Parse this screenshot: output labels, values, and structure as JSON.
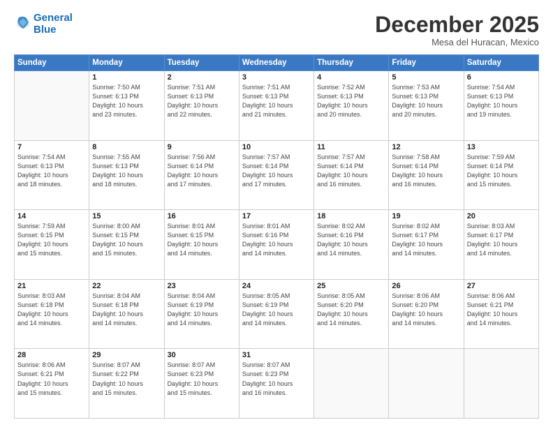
{
  "header": {
    "logo_line1": "General",
    "logo_line2": "Blue",
    "month": "December 2025",
    "location": "Mesa del Huracan, Mexico"
  },
  "weekdays": [
    "Sunday",
    "Monday",
    "Tuesday",
    "Wednesday",
    "Thursday",
    "Friday",
    "Saturday"
  ],
  "weeks": [
    [
      {
        "day": "",
        "info": ""
      },
      {
        "day": "1",
        "info": "Sunrise: 7:50 AM\nSunset: 6:13 PM\nDaylight: 10 hours\nand 23 minutes."
      },
      {
        "day": "2",
        "info": "Sunrise: 7:51 AM\nSunset: 6:13 PM\nDaylight: 10 hours\nand 22 minutes."
      },
      {
        "day": "3",
        "info": "Sunrise: 7:51 AM\nSunset: 6:13 PM\nDaylight: 10 hours\nand 21 minutes."
      },
      {
        "day": "4",
        "info": "Sunrise: 7:52 AM\nSunset: 6:13 PM\nDaylight: 10 hours\nand 20 minutes."
      },
      {
        "day": "5",
        "info": "Sunrise: 7:53 AM\nSunset: 6:13 PM\nDaylight: 10 hours\nand 20 minutes."
      },
      {
        "day": "6",
        "info": "Sunrise: 7:54 AM\nSunset: 6:13 PM\nDaylight: 10 hours\nand 19 minutes."
      }
    ],
    [
      {
        "day": "7",
        "info": "Sunrise: 7:54 AM\nSunset: 6:13 PM\nDaylight: 10 hours\nand 18 minutes."
      },
      {
        "day": "8",
        "info": "Sunrise: 7:55 AM\nSunset: 6:13 PM\nDaylight: 10 hours\nand 18 minutes."
      },
      {
        "day": "9",
        "info": "Sunrise: 7:56 AM\nSunset: 6:14 PM\nDaylight: 10 hours\nand 17 minutes."
      },
      {
        "day": "10",
        "info": "Sunrise: 7:57 AM\nSunset: 6:14 PM\nDaylight: 10 hours\nand 17 minutes."
      },
      {
        "day": "11",
        "info": "Sunrise: 7:57 AM\nSunset: 6:14 PM\nDaylight: 10 hours\nand 16 minutes."
      },
      {
        "day": "12",
        "info": "Sunrise: 7:58 AM\nSunset: 6:14 PM\nDaylight: 10 hours\nand 16 minutes."
      },
      {
        "day": "13",
        "info": "Sunrise: 7:59 AM\nSunset: 6:14 PM\nDaylight: 10 hours\nand 15 minutes."
      }
    ],
    [
      {
        "day": "14",
        "info": "Sunrise: 7:59 AM\nSunset: 6:15 PM\nDaylight: 10 hours\nand 15 minutes."
      },
      {
        "day": "15",
        "info": "Sunrise: 8:00 AM\nSunset: 6:15 PM\nDaylight: 10 hours\nand 15 minutes."
      },
      {
        "day": "16",
        "info": "Sunrise: 8:01 AM\nSunset: 6:15 PM\nDaylight: 10 hours\nand 14 minutes."
      },
      {
        "day": "17",
        "info": "Sunrise: 8:01 AM\nSunset: 6:16 PM\nDaylight: 10 hours\nand 14 minutes."
      },
      {
        "day": "18",
        "info": "Sunrise: 8:02 AM\nSunset: 6:16 PM\nDaylight: 10 hours\nand 14 minutes."
      },
      {
        "day": "19",
        "info": "Sunrise: 8:02 AM\nSunset: 6:17 PM\nDaylight: 10 hours\nand 14 minutes."
      },
      {
        "day": "20",
        "info": "Sunrise: 8:03 AM\nSunset: 6:17 PM\nDaylight: 10 hours\nand 14 minutes."
      }
    ],
    [
      {
        "day": "21",
        "info": "Sunrise: 8:03 AM\nSunset: 6:18 PM\nDaylight: 10 hours\nand 14 minutes."
      },
      {
        "day": "22",
        "info": "Sunrise: 8:04 AM\nSunset: 6:18 PM\nDaylight: 10 hours\nand 14 minutes."
      },
      {
        "day": "23",
        "info": "Sunrise: 8:04 AM\nSunset: 6:19 PM\nDaylight: 10 hours\nand 14 minutes."
      },
      {
        "day": "24",
        "info": "Sunrise: 8:05 AM\nSunset: 6:19 PM\nDaylight: 10 hours\nand 14 minutes."
      },
      {
        "day": "25",
        "info": "Sunrise: 8:05 AM\nSunset: 6:20 PM\nDaylight: 10 hours\nand 14 minutes."
      },
      {
        "day": "26",
        "info": "Sunrise: 8:06 AM\nSunset: 6:20 PM\nDaylight: 10 hours\nand 14 minutes."
      },
      {
        "day": "27",
        "info": "Sunrise: 8:06 AM\nSunset: 6:21 PM\nDaylight: 10 hours\nand 14 minutes."
      }
    ],
    [
      {
        "day": "28",
        "info": "Sunrise: 8:06 AM\nSunset: 6:21 PM\nDaylight: 10 hours\nand 15 minutes."
      },
      {
        "day": "29",
        "info": "Sunrise: 8:07 AM\nSunset: 6:22 PM\nDaylight: 10 hours\nand 15 minutes."
      },
      {
        "day": "30",
        "info": "Sunrise: 8:07 AM\nSunset: 6:23 PM\nDaylight: 10 hours\nand 15 minutes."
      },
      {
        "day": "31",
        "info": "Sunrise: 8:07 AM\nSunset: 6:23 PM\nDaylight: 10 hours\nand 16 minutes."
      },
      {
        "day": "",
        "info": ""
      },
      {
        "day": "",
        "info": ""
      },
      {
        "day": "",
        "info": ""
      }
    ]
  ]
}
